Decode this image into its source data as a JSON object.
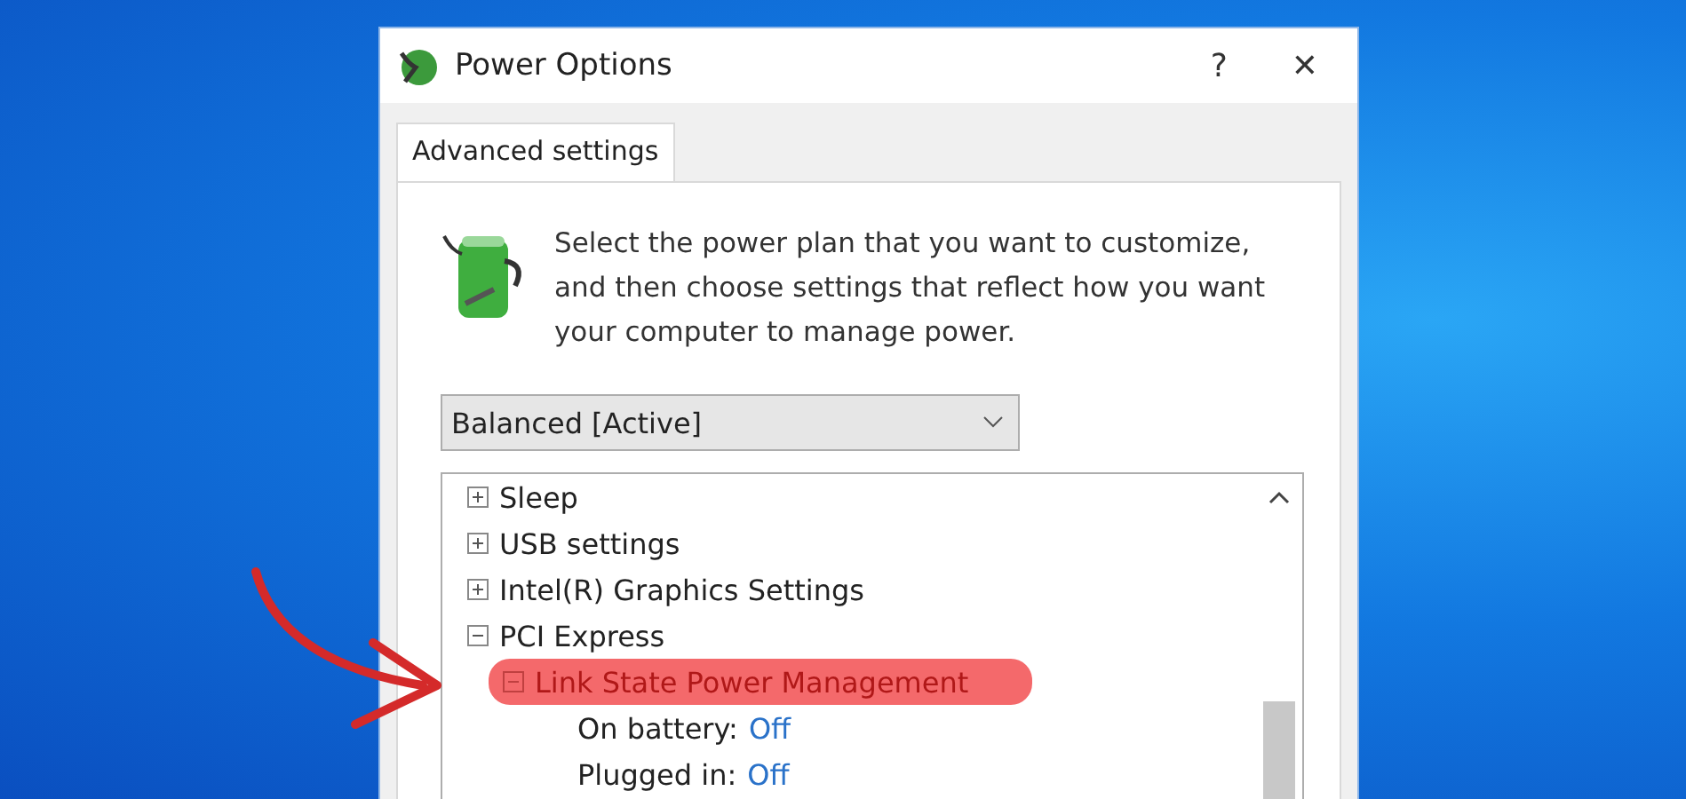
{
  "window": {
    "title": "Power Options",
    "help": "?",
    "close": "✕"
  },
  "tabs": [
    {
      "label": "Advanced settings",
      "selected": true
    }
  ],
  "description": "Select the power plan that you want to customize, and then choose settings that reflect how you want your computer to manage power.",
  "plan_dropdown": {
    "value": "Balanced [Active]"
  },
  "tree": [
    {
      "kind": "group",
      "label": "Sleep",
      "expanded": false,
      "highlighted": false
    },
    {
      "kind": "group",
      "label": "USB settings",
      "expanded": false,
      "highlighted": false
    },
    {
      "kind": "group",
      "label": "Intel(R) Graphics Settings",
      "expanded": false,
      "highlighted": false
    },
    {
      "kind": "group",
      "label": "PCI Express",
      "expanded": true,
      "highlighted": false,
      "children": [
        {
          "kind": "group",
          "label": "Link State Power Management",
          "expanded": true,
          "highlighted": true,
          "children": [
            {
              "kind": "setting",
              "label": "On battery:",
              "value": "Off"
            },
            {
              "kind": "setting",
              "label": "Plugged in:",
              "value": "Off"
            }
          ]
        }
      ]
    }
  ]
}
